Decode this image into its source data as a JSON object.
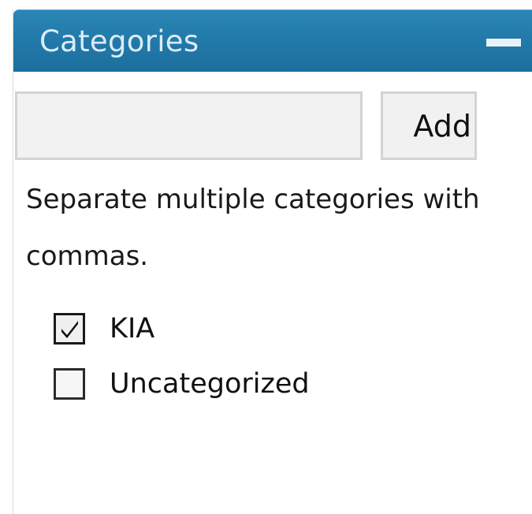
{
  "panel": {
    "title": "Categories",
    "toggle_icon": "minus-icon"
  },
  "add_form": {
    "input_value": "",
    "input_placeholder": "",
    "button_label": "Add"
  },
  "hint": "Separate multiple categories with commas.",
  "categories": [
    {
      "label": "KIA",
      "checked": true
    },
    {
      "label": "Uncategorized",
      "checked": false
    }
  ],
  "colors": {
    "header": "#2178a8",
    "header_text": "#d9ecf6"
  }
}
